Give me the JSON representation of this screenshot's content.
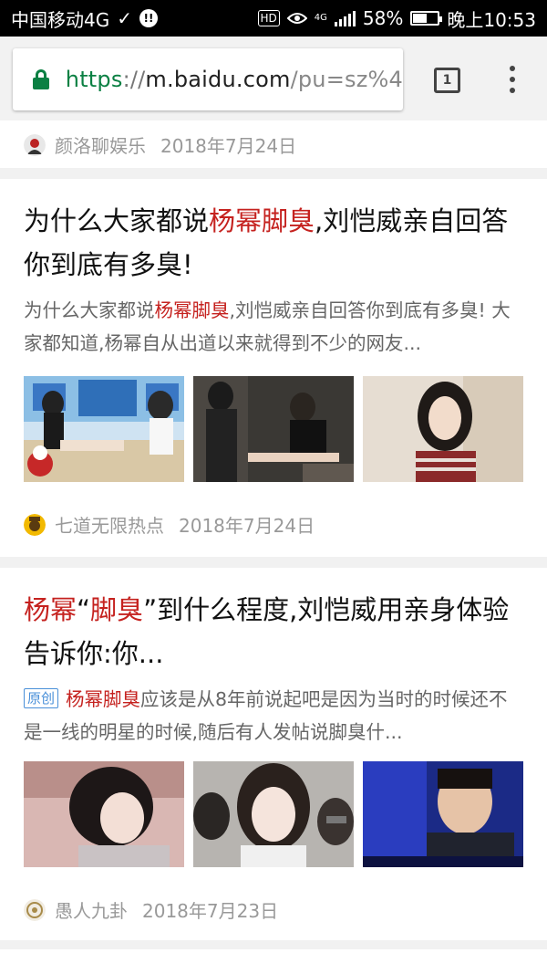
{
  "status_bar": {
    "carrier": "中国移动4G",
    "check_icon": "✓",
    "notif_badge": "!!",
    "hd_badge": "HD",
    "network_label": "4G",
    "battery": "58%",
    "battery_fraction": 0.58,
    "time": "晚上10:53"
  },
  "toolbar": {
    "url_scheme": "https",
    "url_sep": "://",
    "url_host": "m.baidu.com",
    "url_path": "/pu=sz%4",
    "tab_count": "1"
  },
  "results": [
    {
      "source": "颜洛聊娱乐",
      "date": "2018年7月24日"
    },
    {
      "title_part1": "为什么大家都说",
      "title_highlight": "杨幂脚臭",
      "title_part2": ",刘恺威亲自回答你到底有多臭!",
      "abstract_part1": "为什么大家都说",
      "abstract_highlight": "杨幂脚臭",
      "abstract_part2": ",刘恺威亲自回答你到底有多臭! 大家都知道,杨幂自从出道以来就得到不少的网友...",
      "source": "七道无限热点",
      "date": "2018年7月24日"
    },
    {
      "title_highlight1": "杨幂",
      "title_quote_open": "“",
      "title_highlight2": "脚臭",
      "title_rest": "”到什么程度,刘恺威用亲身体验告诉你:你...",
      "tag": "原创",
      "abstract_highlight": "杨幂脚臭",
      "abstract_rest": "应该是从8年前说起吧是因为当时的时候还不是一线的明星的时候,随后有人发帖说脚臭什...",
      "source": "愚人九卦",
      "date": "2018年7月23日"
    }
  ]
}
